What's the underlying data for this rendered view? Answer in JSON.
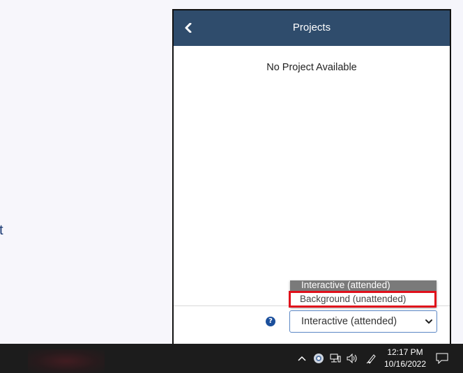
{
  "background": {
    "fragment_text": "t"
  },
  "panel": {
    "title": "Projects",
    "empty_message": "No Project Available",
    "header_color": "#2f4c6c"
  },
  "mode_select": {
    "value": "Interactive (attended)",
    "options": [
      "Interactive (attended)",
      "Background (unattended)"
    ],
    "selected_index": 0,
    "highlighted_option": "Background (unattended)"
  },
  "taskbar": {
    "time": "12:17 PM",
    "date": "10/16/2022",
    "tray_icons": [
      "chevron-up-icon",
      "app-tray-icon",
      "network-icon",
      "volume-icon",
      "pen-icon",
      "notifications-icon"
    ]
  },
  "colors": {
    "highlight_border": "#e0101b",
    "help_icon": "#1b4f9c",
    "select_border": "#5a86c4"
  }
}
